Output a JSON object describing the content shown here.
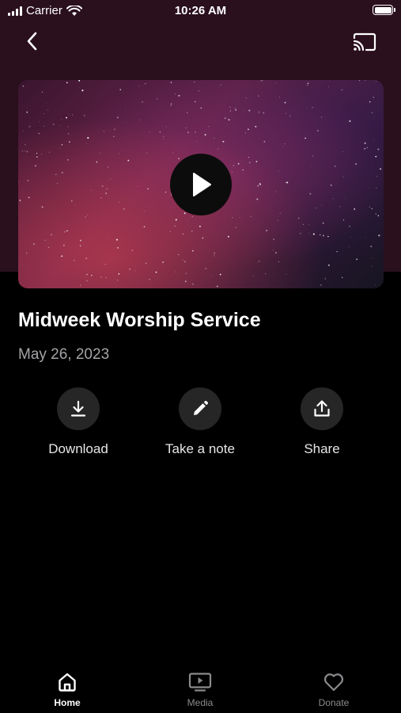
{
  "status_bar": {
    "carrier": "Carrier",
    "time": "10:26 AM",
    "icons": [
      "signal-icon",
      "wifi-icon",
      "battery-icon"
    ]
  },
  "nav": {
    "back_icon": "chevron-left-icon",
    "cast_icon": "cast-icon"
  },
  "video": {
    "play_icon": "play-icon"
  },
  "episode": {
    "title": "Midweek Worship Service",
    "date": "May 26, 2023"
  },
  "actions": [
    {
      "label": "Download",
      "icon": "download-icon"
    },
    {
      "label": "Take a note",
      "icon": "pencil-icon"
    },
    {
      "label": "Share",
      "icon": "share-icon"
    }
  ],
  "tabs": [
    {
      "label": "Home",
      "icon": "home-icon",
      "active": true
    },
    {
      "label": "Media",
      "icon": "tv-play-icon",
      "active": false
    },
    {
      "label": "Donate",
      "icon": "heart-icon",
      "active": false
    }
  ],
  "colors": {
    "hero_background": "#2a0f1d",
    "background": "#000000",
    "action_circle": "#262626",
    "secondary_text": "#a4a4a8",
    "inactive_tab": "#8a8a8e"
  }
}
